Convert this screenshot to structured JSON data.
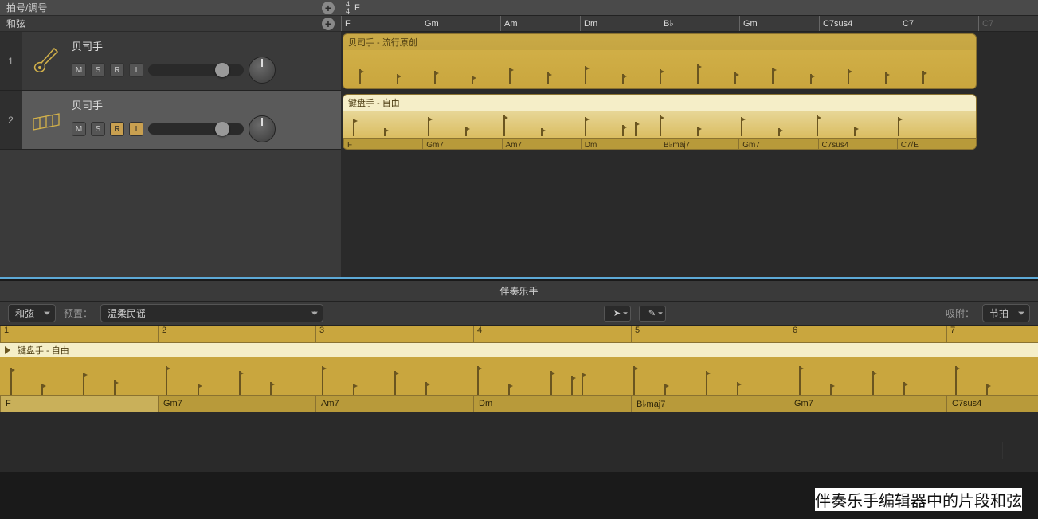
{
  "globalRows": {
    "timeKey": "拍号/调号",
    "chord": "和弦"
  },
  "timesig": {
    "num": "4",
    "den": "4",
    "key": "F"
  },
  "chordRuler": [
    "F",
    "Gm",
    "Am",
    "Dm",
    "B♭",
    "Gm",
    "C7sus4",
    "C7",
    "C7"
  ],
  "tracks": [
    {
      "num": "1",
      "name": "贝司手",
      "btns": [
        "M",
        "S",
        "R",
        "I"
      ],
      "recOn": false
    },
    {
      "num": "2",
      "name": "贝司手",
      "btns": [
        "M",
        "S",
        "R",
        "I"
      ],
      "recOn": true
    }
  ],
  "regions": {
    "bass": {
      "label": "贝司手 - 流行原创"
    },
    "keys": {
      "label": "键盘手 - 自由",
      "chords": [
        "F",
        "Gm7",
        "Am7",
        "Dm",
        "B♭maj7",
        "Gm7",
        "C7sus4",
        "C7/E"
      ]
    }
  },
  "editor": {
    "title": "伴奏乐手",
    "chordDropdown": "和弦",
    "presetLabel": "预置：",
    "presetValue": "温柔民谣",
    "snapLabel": "吸附：",
    "snapValue": "节拍",
    "pointerTool": "➤",
    "pencilTool": "✎",
    "rulerNums": [
      "1",
      "2",
      "3",
      "4",
      "5",
      "6",
      "7"
    ],
    "regionLabel": "键盘手 - 自由",
    "chords": [
      "F",
      "Gm7",
      "Am7",
      "Dm",
      "B♭maj7",
      "Gm7",
      "C7sus4"
    ]
  },
  "callout": "伴奏乐手编辑器中的片段和弦",
  "colors": {
    "regionYellow": "#c9a63e",
    "regionLight": "#f0e6b8"
  }
}
